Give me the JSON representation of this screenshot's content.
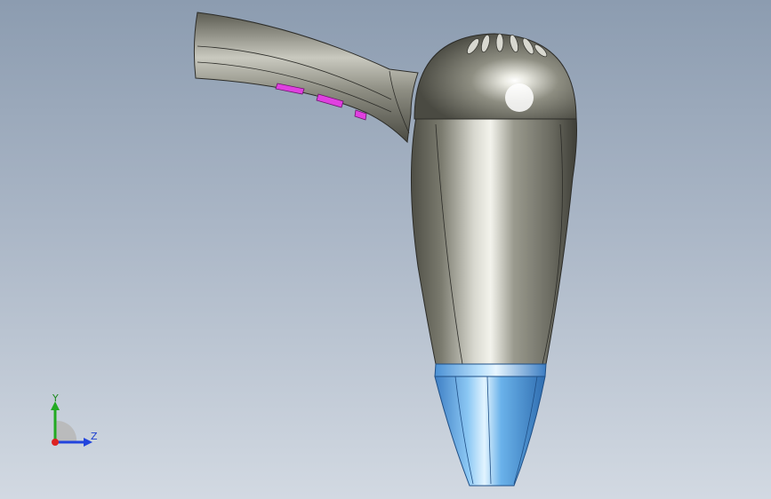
{
  "viewport": {
    "background_top": "#8c9cb0",
    "background_bottom": "#d2d9e2"
  },
  "model": {
    "body_color": "#8a8a7e",
    "body_highlight": "#e4e4dc",
    "nozzle_color": "#5aa6e6",
    "nozzle_highlight": "#c8e6ff",
    "button_color": "#e040e0",
    "vent_count": 6,
    "button_count": 3
  },
  "triad": {
    "y_label": "Y",
    "z_label": "Z",
    "y_color": "#22aa22",
    "z_color": "#2244dd",
    "x_color": "#dd2222"
  }
}
